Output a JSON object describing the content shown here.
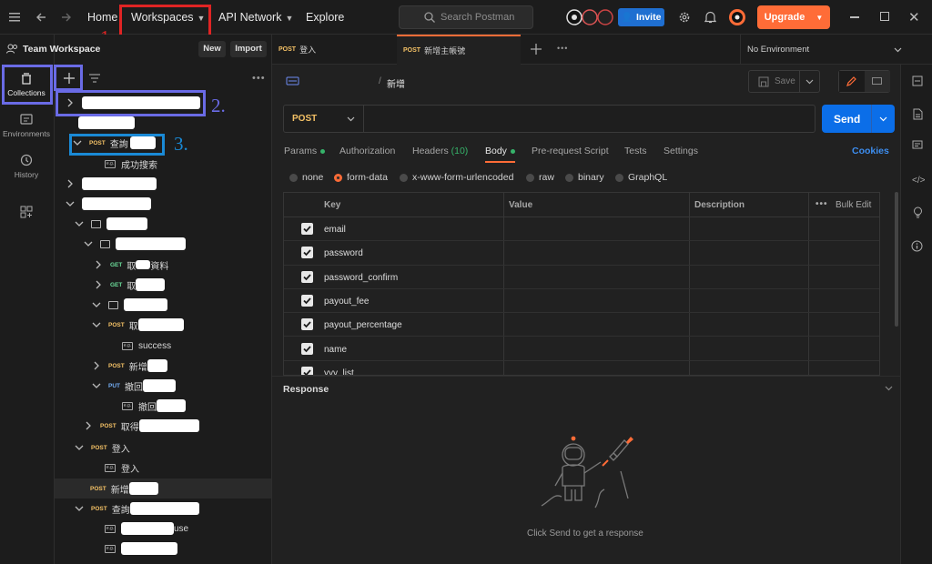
{
  "topbar": {
    "home": "Home",
    "workspaces": "Workspaces",
    "api_network": "API Network",
    "explore": "Explore",
    "search_placeholder": "Search Postman",
    "invite": "Invite",
    "upgrade": "Upgrade"
  },
  "rail": {
    "collections": "Collections",
    "environments": "Environments",
    "history": "History"
  },
  "sidebar": {
    "workspace_name": "Team Workspace",
    "new_label": "New",
    "import_label": "Import",
    "items": {
      "post_query": "查詢",
      "example_success_cn": "成功搜索",
      "get_fetch_data": "取",
      "get_fetch_data_suffix": "資料",
      "get_fetch2": "取",
      "post_fetch3": "取",
      "example_success": "success",
      "post_new": "新增",
      "put_undo": "撤回",
      "example_undo": "撤回",
      "post_fetch_get": "取得",
      "post_login": "登入",
      "example_login": "登入",
      "post_add": "新增",
      "post_query2": "查詢",
      "example_use": "use"
    },
    "methods": {
      "post": "POST",
      "get": "GET",
      "put": "PUT"
    }
  },
  "annotations": {
    "one": "1.",
    "two": "2.",
    "three": "3."
  },
  "tabs": [
    {
      "method": "POST",
      "name": "登入"
    },
    {
      "method": "POST",
      "name": "新增主帳號"
    }
  ],
  "environment": "No Environment",
  "request": {
    "breadcrumb_current": "新增",
    "save_label": "Save",
    "method": "POST",
    "url": "",
    "send_label": "Send",
    "subtabs": [
      "Params",
      "Authorization",
      "Headers",
      "Body",
      "Pre-request Script",
      "Tests",
      "Settings"
    ],
    "headers_count": "(10)",
    "cookies": "Cookies",
    "body_modes": [
      "none",
      "form-data",
      "x-www-form-urlencoded",
      "raw",
      "binary",
      "GraphQL"
    ],
    "body_selected": "form-data",
    "table_headers": {
      "key": "Key",
      "value": "Value",
      "description": "Description",
      "bulk_edit": "Bulk Edit"
    },
    "rows": [
      "email",
      "password",
      "password_confirm",
      "payout_fee",
      "payout_percentage",
      "name",
      "yyy_list"
    ]
  },
  "response": {
    "title": "Response",
    "empty_hint": "Click Send to get a response"
  },
  "colors": {
    "accent": "#ff6c37",
    "send": "#0b6ee8",
    "post": "#f5c266",
    "get": "#6bdd9a",
    "put": "#74aef6"
  }
}
